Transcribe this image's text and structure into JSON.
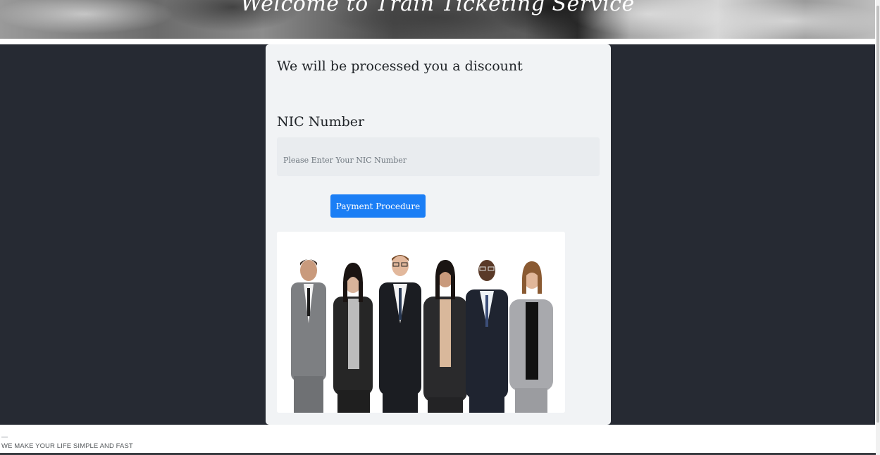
{
  "header": {
    "title": "Welcome to Train Ticketing Service"
  },
  "form": {
    "heading": "We will be processed you a discount",
    "nic_label": "NIC Number",
    "nic_value": "",
    "nic_placeholder": "Please Enter Your NIC Number",
    "submit_label": "Payment Procedure"
  },
  "footer": {
    "tagline": "WE MAKE YOUR LIFE SIMPLE AND FAST"
  },
  "colors": {
    "page_background": "#262a33",
    "card_background": "#f1f3f5",
    "button_primary": "#1b7ef5"
  }
}
